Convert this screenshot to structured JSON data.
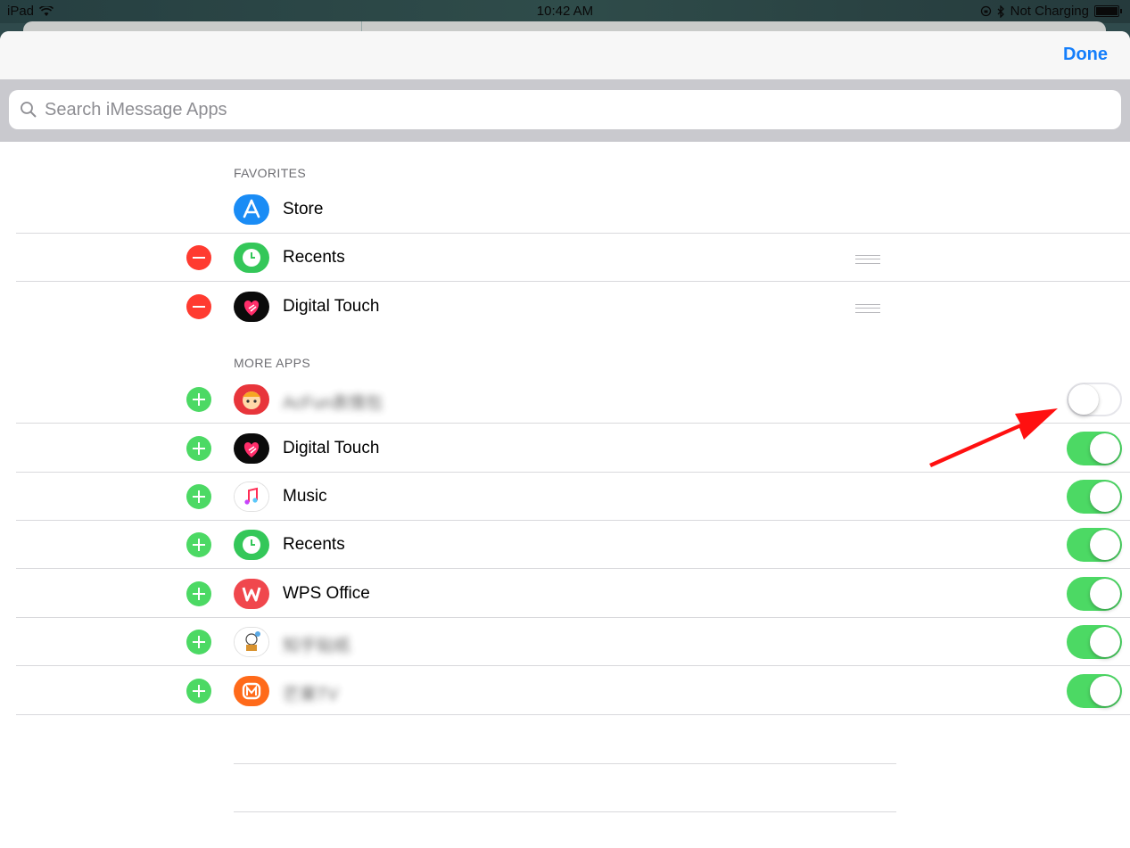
{
  "status": {
    "device": "iPad",
    "time": "10:42 AM",
    "battery": "Not Charging"
  },
  "nav": {
    "done_label": "Done"
  },
  "search": {
    "placeholder": "Search iMessage Apps"
  },
  "favorites": {
    "header": "FAVORITES",
    "items": [
      {
        "label": "Store",
        "icon": "app-store-icon"
      },
      {
        "label": "Recents",
        "icon": "recents-clock-icon"
      },
      {
        "label": "Digital Touch",
        "icon": "digital-touch-heart-icon"
      }
    ]
  },
  "more_apps": {
    "header": "MORE APPS",
    "items": [
      {
        "label": "AcFun表情包",
        "blurred": true,
        "enabled": false,
        "icon": "acfun-app-icon"
      },
      {
        "label": "Digital Touch",
        "enabled": true,
        "icon": "digital-touch-heart-icon"
      },
      {
        "label": "Music",
        "enabled": true,
        "icon": "music-note-icon"
      },
      {
        "label": "Recents",
        "enabled": true,
        "icon": "recents-clock-icon"
      },
      {
        "label": "WPS Office",
        "enabled": true,
        "icon": "wps-office-icon"
      },
      {
        "label": "知乎贴纸",
        "blurred": true,
        "enabled": true,
        "icon": "cartoon-sticker-icon"
      },
      {
        "label": "芒果TV",
        "blurred": true,
        "enabled": true,
        "icon": "mango-tv-icon"
      }
    ]
  },
  "colors": {
    "accent": "#147efb",
    "add": "#4cd964",
    "remove": "#ff3b30",
    "toggle_on": "#4cd964",
    "annotation_arrow": "#ff1010"
  }
}
